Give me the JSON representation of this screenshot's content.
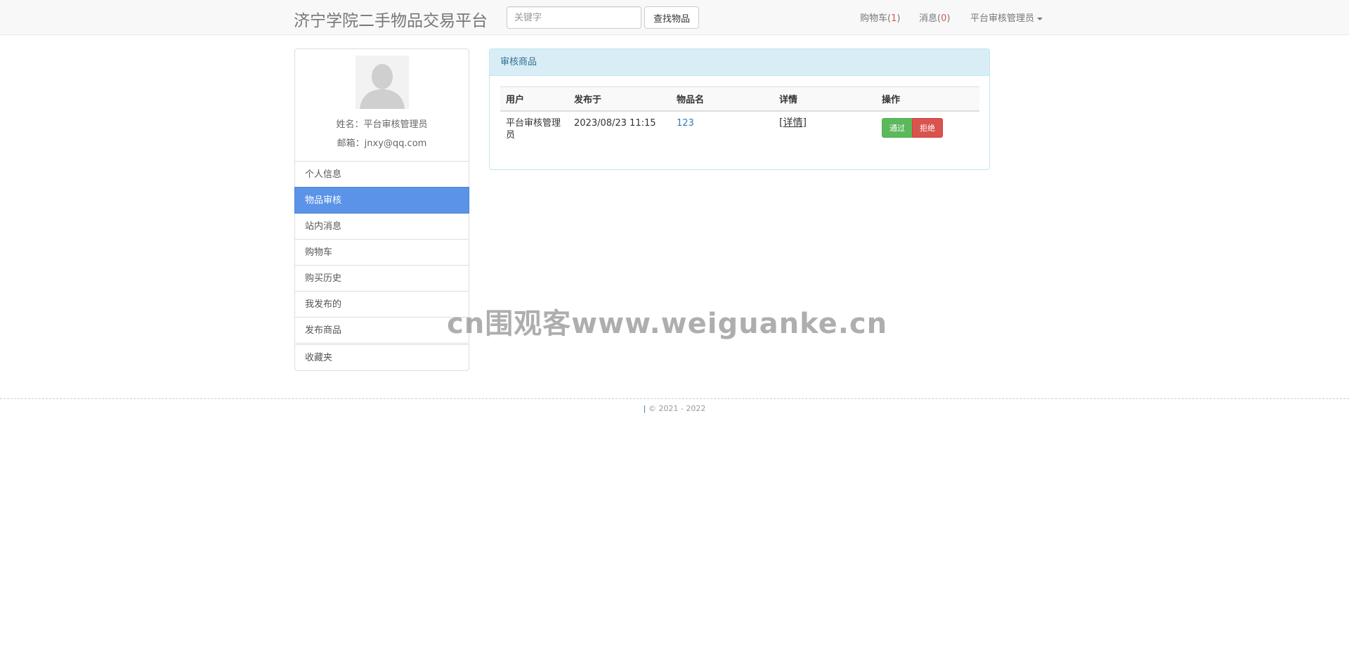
{
  "navbar": {
    "brand": "济宁学院二手物品交易平台",
    "search_placeholder": "关键字",
    "search_button": "查找物品",
    "cart_label": "购物车(",
    "cart_count": "1",
    "cart_close": ")",
    "msg_label": "消息(",
    "msg_count": "0",
    "msg_close": ")",
    "user_menu": "平台审核管理员"
  },
  "profile": {
    "name": "姓名：平台审核管理员",
    "email": "邮箱：jnxy@qq.com"
  },
  "sidebar": {
    "items": [
      {
        "label": "个人信息"
      },
      {
        "label": "物品审核"
      },
      {
        "label": "站内消息"
      },
      {
        "label": "购物车"
      },
      {
        "label": "购买历史"
      },
      {
        "label": "我发布的"
      },
      {
        "label": "发布商品"
      },
      {
        "label": "收藏夹"
      }
    ]
  },
  "panel": {
    "title": "审核商品",
    "columns": [
      "用户",
      "发布于",
      "物品名",
      "详情",
      "操作"
    ],
    "rows": [
      {
        "user": "平台审核管理员",
        "published": "2023/08/23 11:15",
        "item": "123",
        "detail": "[详情]",
        "approve": "通过",
        "reject": "拒绝"
      }
    ]
  },
  "watermark": "cn围观客www.weiguanke.cn",
  "footer": {
    "sep": "|",
    "copyright": "© 2021 - 2022"
  },
  "colors": {
    "active_menu": "#5b93e8",
    "panel_heading": "#d9edf7",
    "approve": "#5cb85c",
    "reject": "#d9534f",
    "link": "#337ab7"
  }
}
